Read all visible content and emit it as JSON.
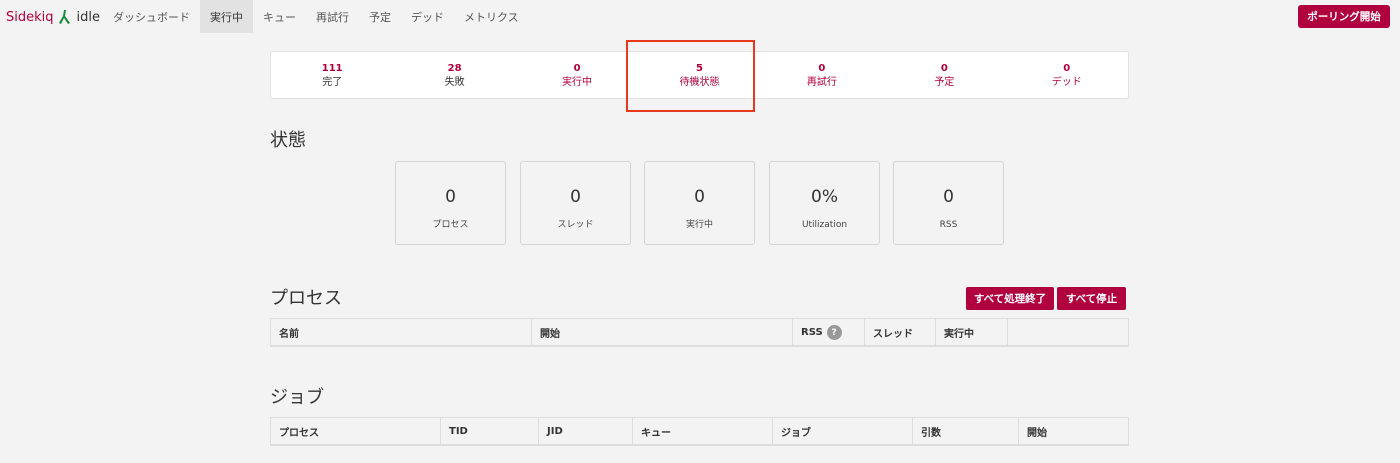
{
  "brand": {
    "name": "Sidekiq",
    "status": "idle"
  },
  "nav": {
    "items": [
      {
        "label": "ダッシュボード",
        "active": false
      },
      {
        "label": "実行中",
        "active": true
      },
      {
        "label": "キュー",
        "active": false
      },
      {
        "label": "再試行",
        "active": false
      },
      {
        "label": "予定",
        "active": false
      },
      {
        "label": "デッド",
        "active": false
      },
      {
        "label": "メトリクス",
        "active": false
      }
    ],
    "poll_button": "ポーリング開始"
  },
  "summary": [
    {
      "count": "111",
      "label": "完了"
    },
    {
      "count": "28",
      "label": "失敗"
    },
    {
      "count": "0",
      "label": "実行中"
    },
    {
      "count": "5",
      "label": "待機状態"
    },
    {
      "count": "0",
      "label": "再試行"
    },
    {
      "count": "0",
      "label": "予定"
    },
    {
      "count": "0",
      "label": "デッド"
    }
  ],
  "status_section": {
    "title": "状態",
    "stats": [
      {
        "value": "0",
        "label": "プロセス"
      },
      {
        "value": "0",
        "label": "スレッド"
      },
      {
        "value": "0",
        "label": "実行中"
      },
      {
        "value": "0%",
        "label": "Utilization"
      },
      {
        "value": "0",
        "label": "RSS"
      }
    ]
  },
  "process_section": {
    "title": "プロセス",
    "quiet_all": "すべて処理終了",
    "stop_all": "すべて停止",
    "columns": [
      "名前",
      "開始",
      "RSS",
      "スレッド",
      "実行中",
      ""
    ],
    "help_icon_text": "?"
  },
  "jobs_section": {
    "title": "ジョブ",
    "columns": [
      "プロセス",
      "TID",
      "JID",
      "キュー",
      "ジョブ",
      "引数",
      "開始"
    ]
  },
  "colors": {
    "accent": "#b1003e",
    "highlight": "#e8391e",
    "background": "#f3f3f3"
  }
}
